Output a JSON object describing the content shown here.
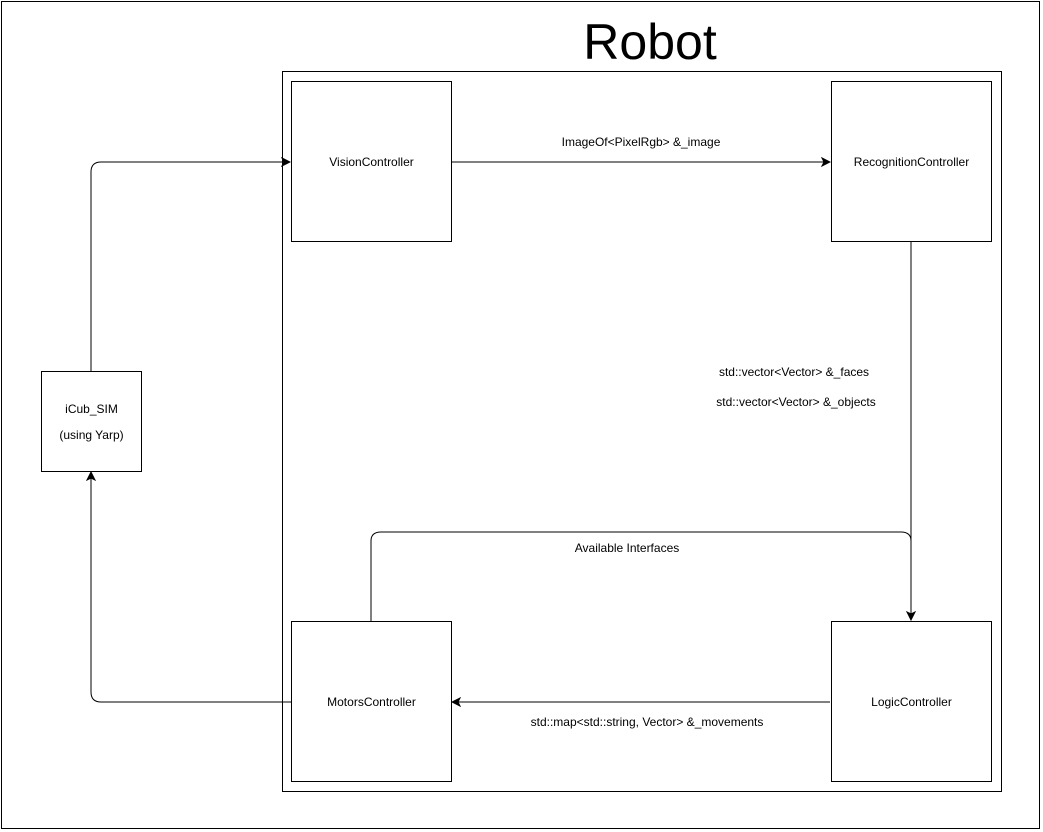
{
  "title": "Robot",
  "nodes": {
    "vision": "VisionController",
    "recognition": "RecognitionController",
    "motors": "MotorsController",
    "logic": "LogicController",
    "icub_line1": "iCub_SIM",
    "icub_line2": "(using Yarp)"
  },
  "edges": {
    "vision_to_recognition": "ImageOf<PixelRgb> &_image",
    "recognition_to_logic_1": "std::vector<Vector> &_faces",
    "recognition_to_logic_2": "std::vector<Vector> &_objects",
    "motors_to_logic": "Available Interfaces",
    "logic_to_motors": "std::map<std::string, Vector> &_movements"
  }
}
